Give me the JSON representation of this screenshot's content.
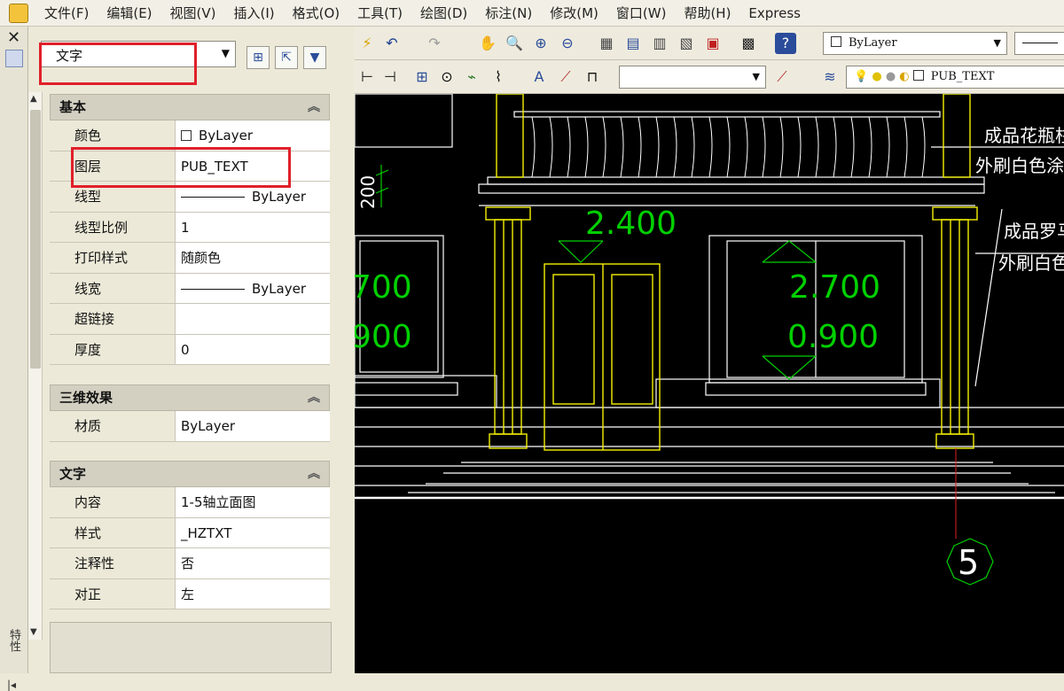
{
  "menu": [
    "文件(F)",
    "编辑(E)",
    "视图(V)",
    "插入(I)",
    "格式(O)",
    "工具(T)",
    "绘图(D)",
    "标注(N)",
    "修改(M)",
    "窗口(W)",
    "帮助(H)",
    "Express"
  ],
  "properties": {
    "object_type": "文字",
    "sections": [
      {
        "title": "基本",
        "rows": [
          {
            "name": "颜色",
            "value": "ByLayer",
            "kind": "swatch"
          },
          {
            "name": "图层",
            "value": "PUB_TEXT"
          },
          {
            "name": "线型",
            "value": "ByLayer",
            "kind": "line"
          },
          {
            "name": "线型比例",
            "value": "1"
          },
          {
            "name": "打印样式",
            "value": "随颜色"
          },
          {
            "name": "线宽",
            "value": "ByLayer",
            "kind": "line"
          },
          {
            "name": "超链接",
            "value": ""
          },
          {
            "name": "厚度",
            "value": "0"
          }
        ]
      },
      {
        "title": "三维效果",
        "rows": [
          {
            "name": "材质",
            "value": "ByLayer"
          }
        ]
      },
      {
        "title": "文字",
        "rows": [
          {
            "name": "内容",
            "value": "1-5轴立面图"
          },
          {
            "name": "样式",
            "value": "_HZTXT"
          },
          {
            "name": "注释性",
            "value": "否"
          },
          {
            "name": "对正",
            "value": "左"
          }
        ]
      }
    ],
    "side_label": "特性"
  },
  "toolbar": {
    "color_combo": "ByLayer",
    "layer_combo": "PUB_TEXT"
  },
  "drawing": {
    "dim_top": "2.400",
    "dim_left_1": "700",
    "dim_left_2": "900",
    "dim_right_1": "2.700",
    "dim_right_2": "0.900",
    "dim_vertical": "200",
    "note_1": "成品花瓶柱",
    "note_2": "外刷白色涂料",
    "note_3": "成品罗马",
    "note_4": "外刷白色",
    "axis_number": "5"
  },
  "colors": {
    "yellow": "#f4f000",
    "green": "#00d000",
    "white": "#ffffff",
    "red_highlight": "#e0202a",
    "axis_red": "#e02020"
  }
}
